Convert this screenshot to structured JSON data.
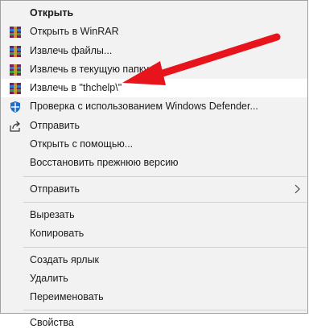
{
  "menu": {
    "open": "Открыть",
    "open_winrar": "Открыть в WinRAR",
    "extract_files": "Извлечь файлы...",
    "extract_here": "Извлечь в текущую папку",
    "extract_to": "Извлечь в \"thchelp\\\"",
    "defender": "Проверка с использованием Windows Defender...",
    "share": "Отправить",
    "open_with": "Открыть с помощью...",
    "restore": "Восстановить прежнюю версию",
    "send_to": "Отправить",
    "cut": "Вырезать",
    "copy": "Копировать",
    "create_shortcut": "Создать ярлык",
    "delete": "Удалить",
    "rename": "Переименовать",
    "properties": "Свойства"
  },
  "colors": {
    "arrow": "#e8141c",
    "highlight": "#ffffff",
    "menu_bg": "#f2f2f2"
  },
  "icons": [
    "winrar-icon",
    "windows-defender-icon",
    "share-icon",
    "chevron-right-icon"
  ]
}
